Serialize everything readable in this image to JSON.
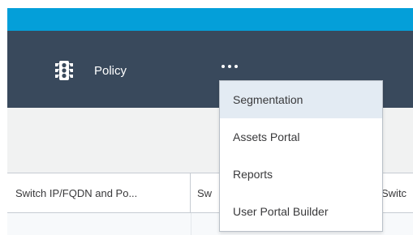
{
  "nav": {
    "policy_label": "Policy",
    "policy_icon": "traffic-light-icon",
    "more_icon": "more-dots-icon"
  },
  "menu": {
    "items": [
      {
        "label": "Segmentation",
        "highlighted": true
      },
      {
        "label": "Assets Portal",
        "highlighted": false
      },
      {
        "label": "Reports",
        "highlighted": false
      },
      {
        "label": "User Portal Builder",
        "highlighted": false
      }
    ]
  },
  "table": {
    "columns": [
      "Switch IP/FQDN and Po...",
      "Sw",
      "Switc"
    ]
  },
  "colors": {
    "top_strip": "#049fd9",
    "navbar": "#39495c",
    "menu_highlight": "#e3ebf3"
  }
}
